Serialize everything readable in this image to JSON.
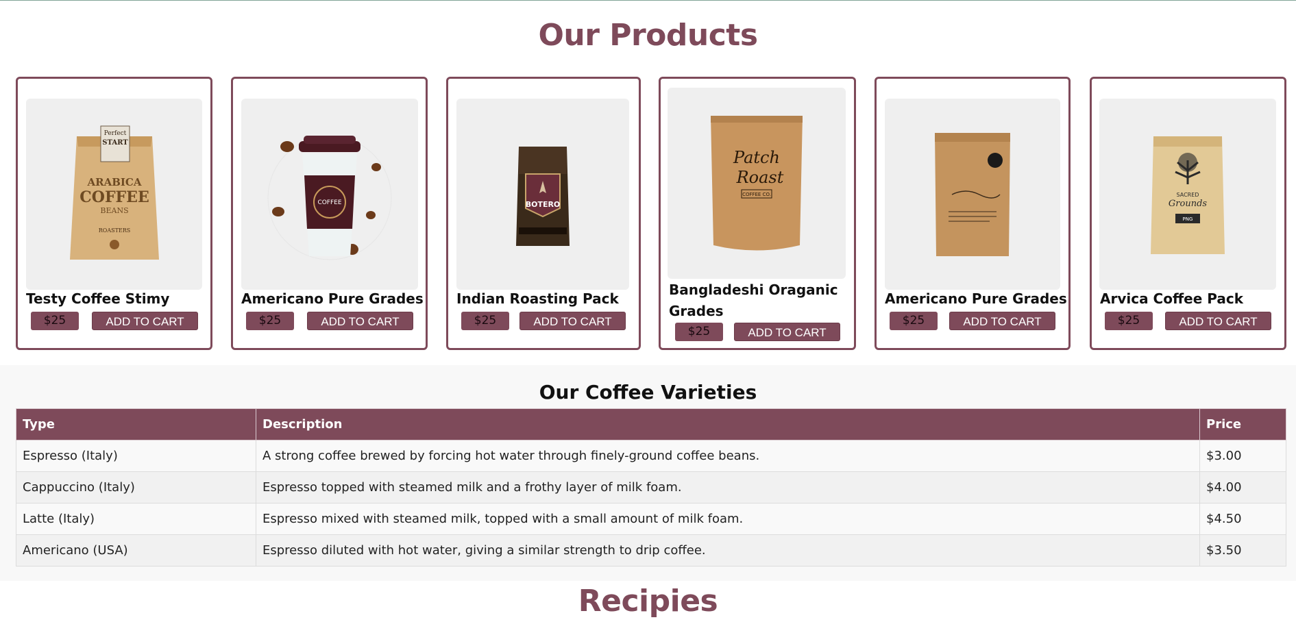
{
  "products_section": {
    "title": "Our Products"
  },
  "products": [
    {
      "name": "Testy Coffee Stimy",
      "price": "$25",
      "cta": "ADD TO CART",
      "image": "arabica-coffee-bag-image"
    },
    {
      "name": "Americano Pure Grades",
      "price": "$25",
      "cta": "ADD TO CART",
      "image": "coffee-cup-image"
    },
    {
      "name": "Indian Roasting Pack",
      "price": "$25",
      "cta": "ADD TO CART",
      "image": "botero-coffee-bag-image"
    },
    {
      "name": "Bangladeshi Oraganic Grades",
      "price": "$25",
      "cta": "ADD TO CART",
      "image": "patch-roast-bag-image"
    },
    {
      "name": "Americano Pure Grades",
      "price": "$25",
      "cta": "ADD TO CART",
      "image": "kraft-coffee-bag-image"
    },
    {
      "name": "Arvica Coffee Pack",
      "price": "$25",
      "cta": "ADD TO CART",
      "image": "sacred-grounds-bag-image"
    }
  ],
  "varieties": {
    "title": "Our Coffee Varieties",
    "headers": [
      "Type",
      "Description",
      "Price"
    ],
    "rows": [
      {
        "type": "Espresso (Italy)",
        "description": "A strong coffee brewed by forcing hot water through finely-ground coffee beans.",
        "price": "$3.00"
      },
      {
        "type": "Cappuccino (Italy)",
        "description": "Espresso topped with steamed milk and a frothy layer of milk foam.",
        "price": "$4.00"
      },
      {
        "type": "Latte (Italy)",
        "description": "Espresso mixed with steamed milk, topped with a small amount of milk foam.",
        "price": "$4.50"
      },
      {
        "type": "Americano (USA)",
        "description": "Espresso diluted with hot water, giving a similar strength to drip coffee.",
        "price": "$3.50"
      }
    ]
  },
  "recipes_section": {
    "title": "Recipies"
  },
  "colors": {
    "accent": "#7e4a5a",
    "band": "#f8f8f8",
    "image_bg": "#efefef"
  },
  "bag_labels": {
    "arabica": [
      "Perfect",
      "START",
      "ARABICA",
      "COFFEE",
      "BEANS",
      "ROASTERS"
    ],
    "cup": "COFFEE",
    "botero": "BOTERO",
    "patch": [
      "Patch",
      "Roast",
      "COFFEE CO."
    ],
    "sacred": [
      "SACRED",
      "Grounds",
      "PNG"
    ]
  }
}
